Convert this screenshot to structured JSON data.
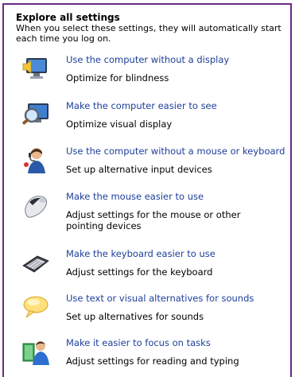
{
  "header": {
    "title": "Explore all settings",
    "description": "When you select these settings, they will automatically start each time you log on."
  },
  "items": [
    {
      "link": "Use the computer without a display",
      "desc": "Optimize for blindness",
      "icon": "monitor-speaker-icon"
    },
    {
      "link": "Make the computer easier to see",
      "desc": "Optimize visual display",
      "icon": "magnifier-monitor-icon"
    },
    {
      "link": "Use the computer without a mouse or keyboard",
      "desc": "Set up alternative input devices",
      "icon": "person-headset-icon"
    },
    {
      "link": "Make the mouse easier to use",
      "desc": "Adjust settings for the mouse or other pointing devices",
      "icon": "mouse-icon"
    },
    {
      "link": "Make the keyboard easier to use",
      "desc": "Adjust settings for the keyboard",
      "icon": "keyboard-icon"
    },
    {
      "link": "Use text or visual alternatives for sounds",
      "desc": "Set up alternatives for sounds",
      "icon": "speech-bubble-icon"
    },
    {
      "link": "Make it easier to focus on tasks",
      "desc": "Adjust settings for reading and typing",
      "icon": "person-book-icon"
    }
  ]
}
